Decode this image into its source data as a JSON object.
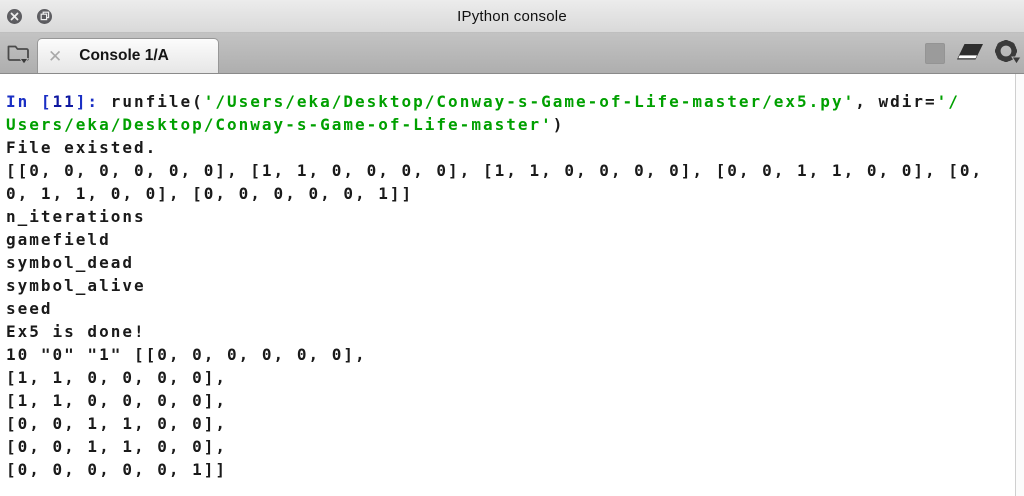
{
  "window": {
    "title": "IPython console"
  },
  "icons": {
    "close": "close-icon",
    "float": "float-pane-icon",
    "browse_tabs": "folder-browse-tabs-icon",
    "tab_close_glyph": "✕",
    "stop": "stop-square-icon",
    "eraser": "eraser-icon",
    "gear": "gear-options-icon"
  },
  "tabbar": {
    "tab_label": "Console 1/A"
  },
  "colors": {
    "prompt_blue": "#1a2fc4",
    "prompt_num": "#0d17a0",
    "string_green": "#00a000",
    "text_black": "#1a1a1a",
    "tabbar_gray": "#b3b3b3"
  },
  "console": {
    "lines": [
      [
        {
          "c": "p",
          "t": "In ["
        },
        {
          "c": "pb",
          "t": "11"
        },
        {
          "c": "p",
          "t": "]: "
        },
        {
          "c": "k",
          "t": "runfile("
        },
        {
          "c": "g",
          "t": "'/Users/eka/Desktop/Conway-s-Game-of-Life-master/ex5.py'"
        },
        {
          "c": "k",
          "t": ", wdir="
        },
        {
          "c": "g",
          "t": "'/"
        }
      ],
      [
        {
          "c": "g",
          "t": "Users/eka/Desktop/Conway-s-Game-of-Life-master'"
        },
        {
          "c": "k",
          "t": ")"
        }
      ],
      [
        {
          "c": "k",
          "t": "File existed."
        }
      ],
      [
        {
          "c": "k",
          "t": "[[0, 0, 0, 0, 0, 0], [1, 1, 0, 0, 0, 0], [1, 1, 0, 0, 0, 0], [0, 0, 1, 1, 0, 0], [0,"
        }
      ],
      [
        {
          "c": "k",
          "t": "0, 1, 1, 0, 0], [0, 0, 0, 0, 0, 1]]"
        }
      ],
      [
        {
          "c": "k",
          "t": "n_iterations"
        }
      ],
      [
        {
          "c": "k",
          "t": "gamefield"
        }
      ],
      [
        {
          "c": "k",
          "t": "symbol_dead"
        }
      ],
      [
        {
          "c": "k",
          "t": "symbol_alive"
        }
      ],
      [
        {
          "c": "k",
          "t": "seed"
        }
      ],
      [
        {
          "c": "k",
          "t": "Ex5 is done!"
        }
      ],
      [
        {
          "c": "k",
          "t": "10 \"0\" \"1\" [[0, 0, 0, 0, 0, 0],"
        }
      ],
      [
        {
          "c": "k",
          "t": "[1, 1, 0, 0, 0, 0],"
        }
      ],
      [
        {
          "c": "k",
          "t": "[1, 1, 0, 0, 0, 0],"
        }
      ],
      [
        {
          "c": "k",
          "t": "[0, 0, 1, 1, 0, 0],"
        }
      ],
      [
        {
          "c": "k",
          "t": "[0, 0, 1, 1, 0, 0],"
        }
      ],
      [
        {
          "c": "k",
          "t": "[0, 0, 0, 0, 0, 1]]"
        }
      ]
    ]
  }
}
